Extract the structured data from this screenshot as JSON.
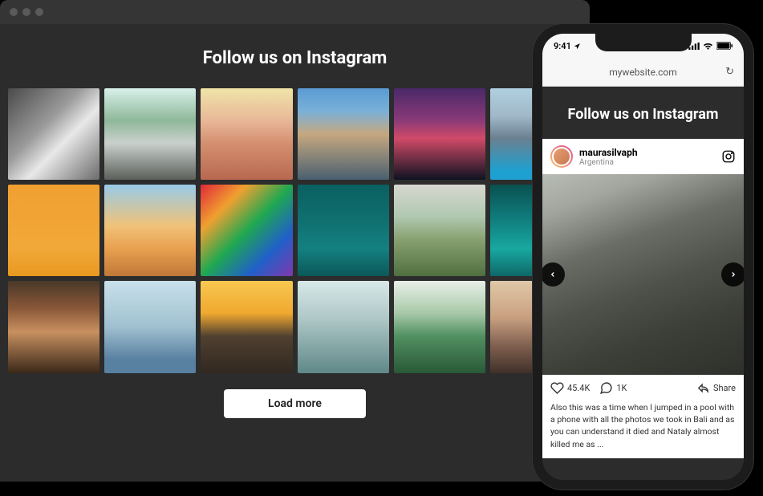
{
  "browser": {
    "heading": "Follow us on Instagram",
    "load_more_label": "Load more",
    "grid": [
      {
        "bg": "linear-gradient(135deg,#4a4a4a,#9a9a9a 40%,#e8e8e8 60%,#6b6b6b)"
      },
      {
        "bg": "linear-gradient(180deg,#d8f0ea 0%,#8fb89a 35%,#c9d0cc 60%,#5b5f5a)"
      },
      {
        "bg": "linear-gradient(180deg,#f0e4a8 0%,#e8b898 35%,#d49070 60%,#b86850)"
      },
      {
        "bg": "linear-gradient(180deg,#5a9bd4 0%,#7ab0d8 25%,#c6a880 50%,#4a6070)"
      },
      {
        "bg": "linear-gradient(180deg,#4a2868 0%,#8a3a78 35%,#d04a68 55%,#0e1220)"
      },
      {
        "bg": "linear-gradient(180deg,#b0d0e0 0%,#a0b8c8 30%,#6a8090 55%,#1ea0d0 90%)"
      },
      {
        "bg": "linear-gradient(180deg,#f0a030 0%,#f2a838 70%,#e89820 100%)"
      },
      {
        "bg": "linear-gradient(180deg,#98cbe8 0%,#f0c278 45%,#e8a050 70%,#c07838)"
      },
      {
        "bg": "linear-gradient(135deg,#e02838 0%,#f0a030 25%,#20a850 50%,#2060c8 75%,#8038b0)"
      },
      {
        "bg": "linear-gradient(180deg,#0a6060 0%,#107070 40%,#148080 70%,#0c5858)"
      },
      {
        "bg": "linear-gradient(180deg,#d8d8d0 0%,#b0c8b0 35%,#88a070 60%,#507040)"
      },
      {
        "bg": "linear-gradient(180deg,#0a5050 0%,#108080 40%,#18a8a0 70%,#0e6868)"
      },
      {
        "bg": "linear-gradient(180deg,#4a3828 0%,#8a5838 30%,#c89060 55%,#3a2818)"
      },
      {
        "bg": "linear-gradient(180deg,#c8e0ea 0%,#a0c0d0 50%,#5880a0 85%)"
      },
      {
        "bg": "linear-gradient(180deg,#f8c850 0%,#f0a830 35%,#504030 60%,#302820)"
      },
      {
        "bg": "linear-gradient(180deg,#d8e8e8 0%,#b0c8c8 40%,#88a8a8 70%,#608888)"
      },
      {
        "bg": "linear-gradient(180deg,#e8f0e8 0%,#a8c8a8 35%,#509060 60%,#2a5838)"
      },
      {
        "bg": "linear-gradient(180deg,#e0c8a8 0%,#c8a080 40%,#806050 70%,#403028)"
      }
    ]
  },
  "phone": {
    "status_time": "9:41",
    "url": "mywebsite.com",
    "heading": "Follow us on Instagram",
    "post": {
      "username": "maurasilvaph",
      "location": "Argentina",
      "likes": "45.4K",
      "comments": "1K",
      "share": "Share",
      "caption": "Also this was a time when I jumped in a pool with a phone with all the photos we took in Bali and as you can understand it died and Nataly almost killed me as ..."
    }
  }
}
